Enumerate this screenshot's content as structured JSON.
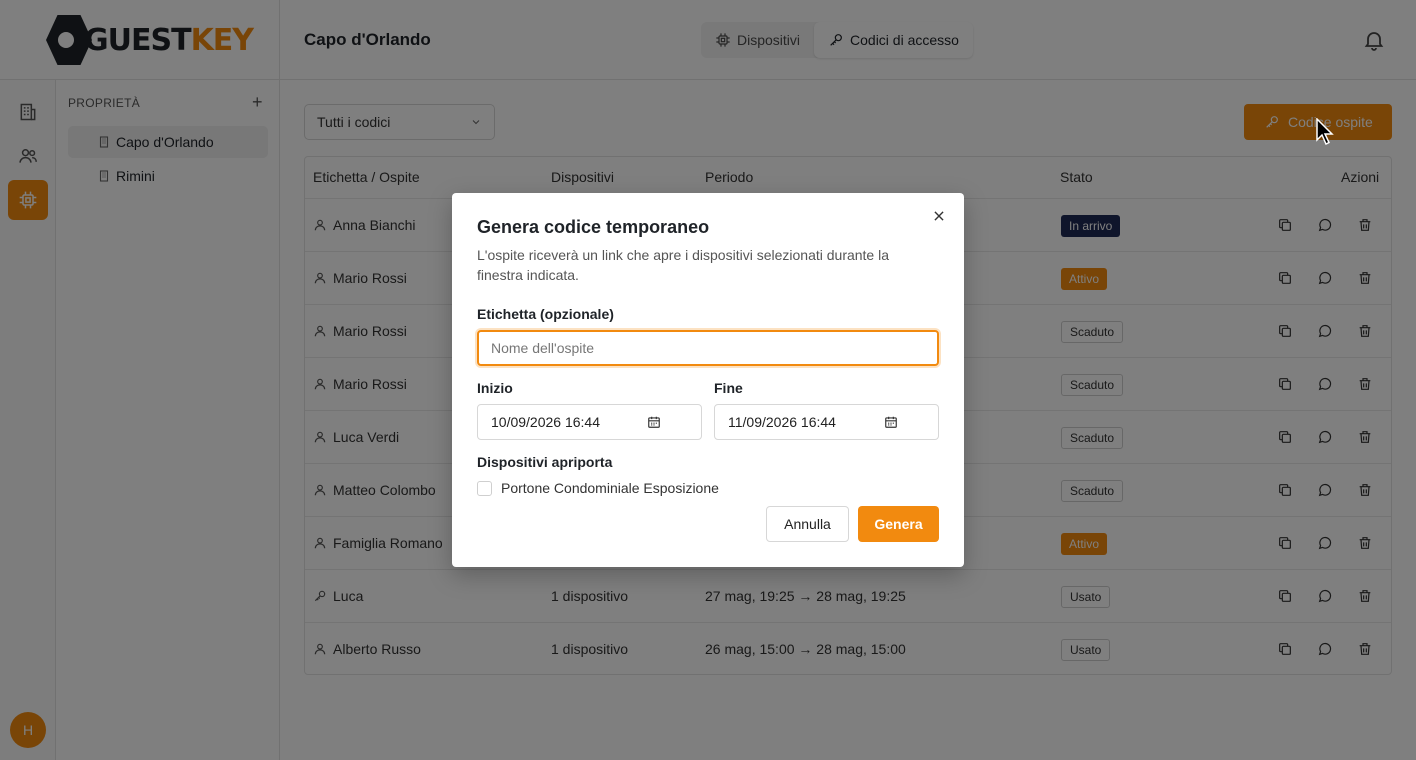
{
  "app": {
    "logo_part1": "GUEST",
    "logo_part2": "KEY",
    "page_title": "Capo d'Orlando",
    "accent_color": "#f28a0f",
    "user_initial": "H"
  },
  "header": {
    "tabs": [
      {
        "label": "Dispositivi",
        "icon": "chip-icon",
        "active": false
      },
      {
        "label": "Codici di accesso",
        "icon": "key-icon",
        "active": true
      }
    ]
  },
  "sidebar": {
    "section_title": "PROPRIETÀ",
    "add_label": "+",
    "items": [
      {
        "label": "Capo d'Orlando",
        "active": true
      },
      {
        "label": "Rimini",
        "active": false
      }
    ]
  },
  "main": {
    "filter_value": "Tutti i codici",
    "primary_button": "Codice ospite",
    "table": {
      "headers": [
        "Etichetta / Ospite",
        "Dispositivi",
        "Periodo",
        "Stato",
        "Azioni"
      ],
      "rows": [
        {
          "label": "Anna Bianchi",
          "icon": "user-icon",
          "devices": "",
          "period": "",
          "status": "In arrivo",
          "status_style": "dark"
        },
        {
          "label": "Mario Rossi",
          "icon": "user-icon",
          "devices": "",
          "period": "",
          "status": "Attivo",
          "status_style": "orange"
        },
        {
          "label": "Mario Rossi",
          "icon": "user-icon",
          "devices": "",
          "period": "",
          "status": "Scaduto",
          "status_style": "grey"
        },
        {
          "label": "Mario Rossi",
          "icon": "user-icon",
          "devices": "",
          "period": "",
          "status": "Scaduto",
          "status_style": "grey"
        },
        {
          "label": "Luca Verdi",
          "icon": "user-icon",
          "devices": "",
          "period": "",
          "status": "Scaduto",
          "status_style": "grey"
        },
        {
          "label": "Matteo Colombo",
          "icon": "user-icon",
          "devices": "",
          "period": "",
          "status": "Scaduto",
          "status_style": "grey"
        },
        {
          "label": "Famiglia Romano",
          "icon": "user-icon",
          "devices": "",
          "period": "",
          "status": "Attivo",
          "status_style": "orange"
        },
        {
          "label": "Luca",
          "icon": "key-icon",
          "devices": "1 dispositivo",
          "period": "27 mag, 19:25 → 28 mag, 19:25",
          "status": "Usato",
          "status_style": "grey"
        },
        {
          "label": "Alberto Russo",
          "icon": "user-icon",
          "devices": "1 dispositivo",
          "period": "26 mag, 15:00 → 28 mag, 15:00",
          "status": "Usato",
          "status_style": "grey"
        }
      ]
    }
  },
  "modal": {
    "title": "Genera codice temporaneo",
    "description": "L'ospite riceverà un link che apre i dispositivi selezionati durante la finestra indicata.",
    "label_field": "Etichetta (opzionale)",
    "label_placeholder": "Nome dell'ospite",
    "start_label": "Inizio",
    "start_value": "10/09/2026 16:44",
    "end_label": "Fine",
    "end_value": "11/09/2026 16:44",
    "devices_label": "Dispositivi apriporta",
    "device_option": "Portone Condominiale Esposizione",
    "device_checked": false,
    "cancel_label": "Annulla",
    "submit_label": "Genera"
  }
}
